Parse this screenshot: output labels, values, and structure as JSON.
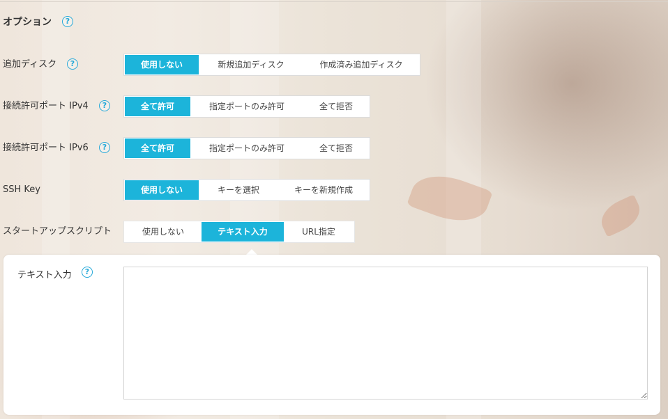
{
  "section": {
    "title": "オプション"
  },
  "rows": {
    "disk": {
      "label": "追加ディスク",
      "options": [
        "使用しない",
        "新規追加ディスク",
        "作成済み追加ディスク"
      ],
      "selected": "使用しない"
    },
    "ipv4": {
      "label": "接続許可ポート IPv4",
      "options": [
        "全て許可",
        "指定ポートのみ許可",
        "全て拒否"
      ],
      "selected": "全て許可"
    },
    "ipv6": {
      "label": "接続許可ポート IPv6",
      "options": [
        "全て許可",
        "指定ポートのみ許可",
        "全て拒否"
      ],
      "selected": "全て許可"
    },
    "ssh": {
      "label": "SSH Key",
      "options": [
        "使用しない",
        "キーを選択",
        "キーを新規作成"
      ],
      "selected": "使用しない"
    },
    "startup": {
      "label": "スタートアップスクリプト",
      "options": [
        "使用しない",
        "テキスト入力",
        "URL指定"
      ],
      "selected": "テキスト入力"
    }
  },
  "panel": {
    "label": "テキスト入力",
    "textarea_value": ""
  },
  "icons": {
    "help": "?"
  },
  "colors": {
    "accent": "#1cb4da",
    "help": "#26a9d9"
  }
}
